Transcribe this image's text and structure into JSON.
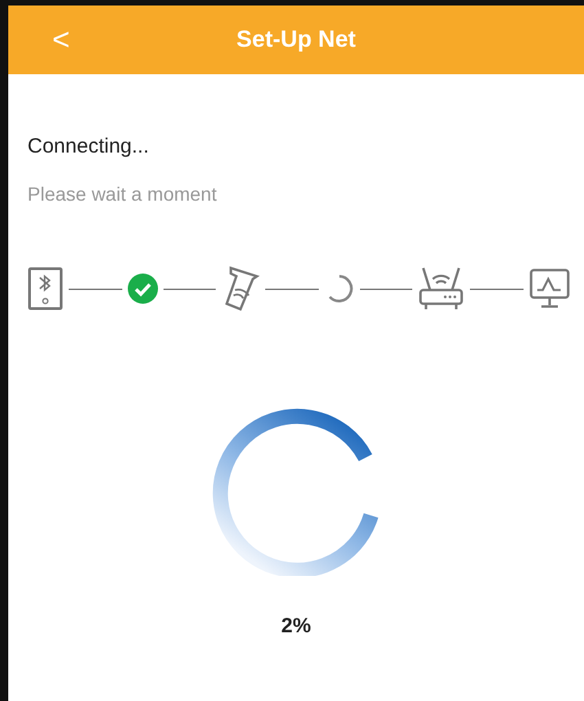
{
  "header": {
    "back": "<",
    "title": "Set-Up Net"
  },
  "status": {
    "title": "Connecting...",
    "subtitle": "Please wait a moment"
  },
  "steps": [
    {
      "kind": "phone"
    },
    {
      "kind": "done"
    },
    {
      "kind": "sensor"
    },
    {
      "kind": "loading"
    },
    {
      "kind": "router"
    },
    {
      "kind": "monitor"
    }
  ],
  "progress": {
    "reading": "2%"
  }
}
